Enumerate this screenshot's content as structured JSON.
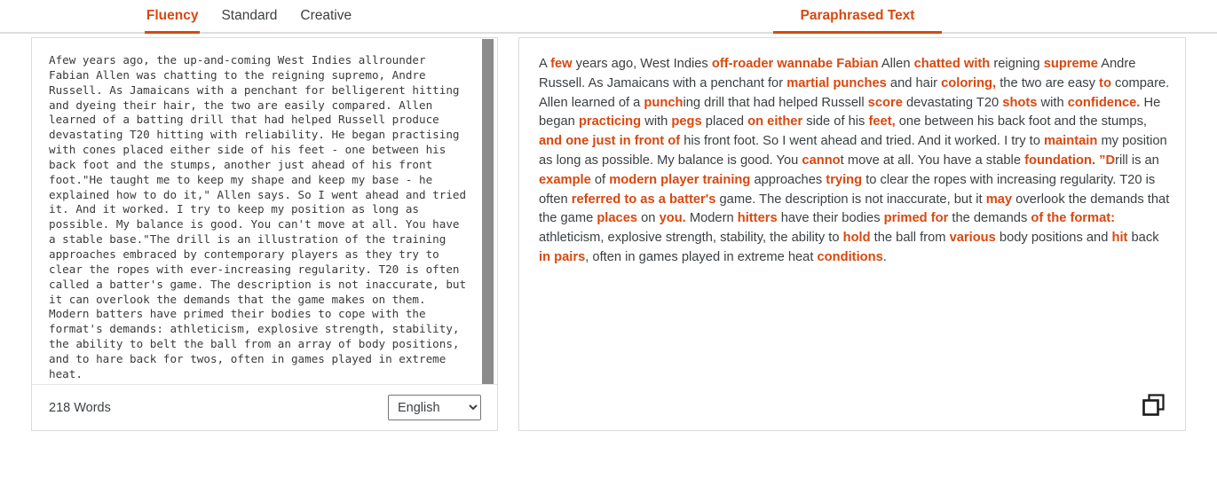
{
  "header": {
    "left_tabs": [
      {
        "label": "Fluency",
        "active": true
      },
      {
        "label": "Standard",
        "active": false
      },
      {
        "label": "Creative",
        "active": false
      }
    ],
    "right_tab": {
      "label": "Paraphrased Text",
      "active": true
    }
  },
  "colors": {
    "accent": "#d9480f",
    "text": "#3c4043",
    "panel_border": "#d8dce0",
    "scrollbar_thumb": "#8b8b8b",
    "tabbar_divider": "#dedede"
  },
  "source_panel": {
    "text": "Afew years ago, the up-and-coming West Indies allrounder Fabian Allen was chatting to the reigning supremo, Andre Russell. As Jamaicans with a penchant for belligerent hitting and dyeing their hair, the two are easily compared. Allen learned of a batting drill that had helped Russell produce devastating T20 hitting with reliability. He began practising with cones placed either side of his feet - one between his back foot and the stumps, another just ahead of his front foot.\"He taught me to keep my shape and keep my base - he explained how to do it,\" Allen says. So I went ahead and tried it. And it worked. I try to keep my position as long as possible. My balance is good. You can't move at all. You have a stable base.\"The drill is an illustration of the training approaches embraced by contemporary players as they try to clear the ropes with ever-increasing regularity. T20 is often called a batter's game. The description is not inaccurate, but it can overlook the demands that the game makes on them. Modern batters have primed their bodies to cope with the format's demands: athleticism, explosive strength, stability, the ability to belt the ball from an array of body positions, and to hare back for twos, often in games played in extreme heat.",
    "word_count_label": "218 Words",
    "language_selected": "English",
    "language_options": [
      "English"
    ],
    "scrollbar": {
      "present": true,
      "thumb_position": "top"
    }
  },
  "paraphrased_panel": {
    "segments": [
      {
        "t": "A ",
        "hl": false
      },
      {
        "t": "few",
        "hl": true
      },
      {
        "t": " years ago, West Indies ",
        "hl": false
      },
      {
        "t": "off-roader wannabe Fabian",
        "hl": true
      },
      {
        "t": " Allen ",
        "hl": false
      },
      {
        "t": "chatted with",
        "hl": true
      },
      {
        "t": " reigning ",
        "hl": false
      },
      {
        "t": "supreme",
        "hl": true
      },
      {
        "t": " Andre Russell. As Jamaicans with a penchant for ",
        "hl": false
      },
      {
        "t": "martial punches",
        "hl": true
      },
      {
        "t": " and hair ",
        "hl": false
      },
      {
        "t": "coloring,",
        "hl": true
      },
      {
        "t": " the two are easy ",
        "hl": false
      },
      {
        "t": "to",
        "hl": true
      },
      {
        "t": " compare. Allen learned of a ",
        "hl": false
      },
      {
        "t": "punch",
        "hl": true
      },
      {
        "t": "ing drill that had helped Russell ",
        "hl": false
      },
      {
        "t": "score",
        "hl": true
      },
      {
        "t": " devastating T20 ",
        "hl": false
      },
      {
        "t": "shots",
        "hl": true
      },
      {
        "t": " with ",
        "hl": false
      },
      {
        "t": "confidence.",
        "hl": true
      },
      {
        "t": " He began ",
        "hl": false
      },
      {
        "t": "practicing",
        "hl": true
      },
      {
        "t": " with ",
        "hl": false
      },
      {
        "t": "pegs",
        "hl": true
      },
      {
        "t": " placed ",
        "hl": false
      },
      {
        "t": "on either",
        "hl": true
      },
      {
        "t": " side of his ",
        "hl": false
      },
      {
        "t": "feet,",
        "hl": true
      },
      {
        "t": " one between his back foot and the stumps, ",
        "hl": false
      },
      {
        "t": "and one just in front of",
        "hl": true
      },
      {
        "t": " his front foot. So I went ahead and tried. And it worked. I try to ",
        "hl": false
      },
      {
        "t": "maintain",
        "hl": true
      },
      {
        "t": " my position as long as possible. My balance is good. You ",
        "hl": false
      },
      {
        "t": "canno",
        "hl": true
      },
      {
        "t": "t move at all. You have a stable ",
        "hl": false
      },
      {
        "t": "foundation. ”D",
        "hl": true
      },
      {
        "t": "rill is an ",
        "hl": false
      },
      {
        "t": "example",
        "hl": true
      },
      {
        "t": " of ",
        "hl": false
      },
      {
        "t": "modern player training",
        "hl": true
      },
      {
        "t": " approaches ",
        "hl": false
      },
      {
        "t": "trying",
        "hl": true
      },
      {
        "t": " to clear the ropes with increasing regularity. T20 is often ",
        "hl": false
      },
      {
        "t": "referred to as a batter's",
        "hl": true
      },
      {
        "t": " game. The description is not inaccurate, but it ",
        "hl": false
      },
      {
        "t": "may",
        "hl": true
      },
      {
        "t": " overlook the demands that the game ",
        "hl": false
      },
      {
        "t": "places",
        "hl": true
      },
      {
        "t": " on ",
        "hl": false
      },
      {
        "t": "you.",
        "hl": true
      },
      {
        "t": " Modern ",
        "hl": false
      },
      {
        "t": "hitters",
        "hl": true
      },
      {
        "t": " have their bodies ",
        "hl": false
      },
      {
        "t": "primed for",
        "hl": true
      },
      {
        "t": " the demands ",
        "hl": false
      },
      {
        "t": "of the format:",
        "hl": true
      },
      {
        "t": " athleticism, explosive strength, stability, the ability to ",
        "hl": false
      },
      {
        "t": "hold",
        "hl": true
      },
      {
        "t": " the ball from ",
        "hl": false
      },
      {
        "t": "various",
        "hl": true
      },
      {
        "t": " body positions and ",
        "hl": false
      },
      {
        "t": "hit",
        "hl": true
      },
      {
        "t": " back ",
        "hl": false
      },
      {
        "t": "in pairs",
        "hl": true
      },
      {
        "t": ", often in games played in extreme heat ",
        "hl": false
      },
      {
        "t": "conditions",
        "hl": true
      },
      {
        "t": ".",
        "hl": false
      }
    ],
    "copy_icon": "copy-icon"
  }
}
